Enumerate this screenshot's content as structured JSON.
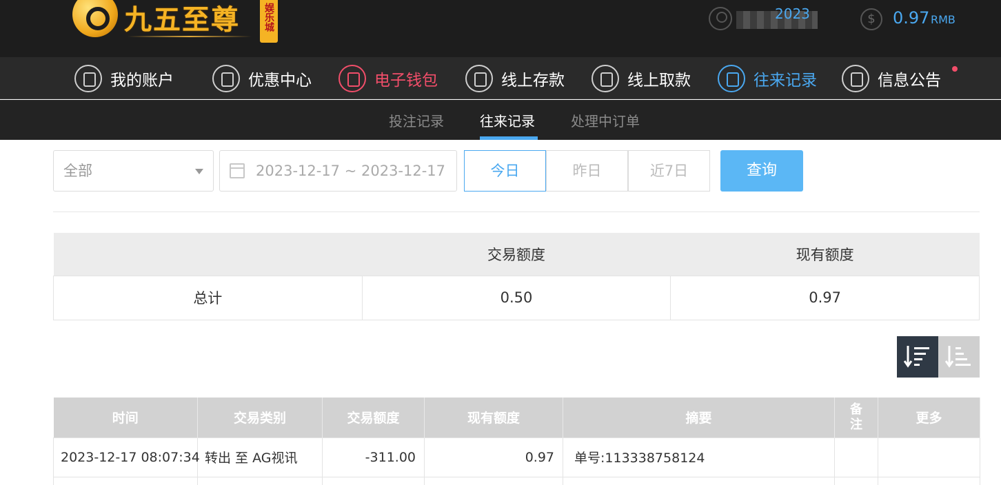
{
  "header": {
    "logo_text": "九五至尊",
    "logo_tag": "娱乐城",
    "username": "2023",
    "balance": "0.97",
    "currency": "RMB"
  },
  "nav": {
    "items": [
      {
        "label": "我的账户",
        "icon": "user-icon"
      },
      {
        "label": "优惠中心",
        "icon": "gift-icon"
      },
      {
        "label": "电子钱包",
        "icon": "wallet-icon"
      },
      {
        "label": "线上存款",
        "icon": "deposit-icon"
      },
      {
        "label": "线上取款",
        "icon": "withdraw-icon"
      },
      {
        "label": "往来记录",
        "icon": "records-icon"
      },
      {
        "label": "信息公告",
        "icon": "bell-icon"
      }
    ]
  },
  "subnav": {
    "tabs": [
      "投注记录",
      "往来记录",
      "处理中订单"
    ],
    "active": "往来记录"
  },
  "filters": {
    "type_select": "全部",
    "date_range": "2023-12-17 ~ 2023-12-17",
    "quick": [
      "今日",
      "昨日",
      "近7日"
    ],
    "search_label": "查询"
  },
  "summary": {
    "headers": [
      "",
      "交易额度",
      "现有额度"
    ],
    "row": [
      "总计",
      "0.50",
      "0.97"
    ]
  },
  "records": {
    "headers": [
      "时间",
      "交易类别",
      "交易额度",
      "现有额度",
      "摘要",
      "备注",
      "更多"
    ],
    "rows": [
      [
        "2023-12-17 08:07:34",
        "转出 至 AG视讯",
        "-311.00",
        "0.97",
        "单号:113338758124",
        "",
        ""
      ]
    ]
  },
  "colors": {
    "accent_blue": "#4aa8f0",
    "accent_red": "#f24e6a",
    "header_bg": "#1d1d1d"
  }
}
